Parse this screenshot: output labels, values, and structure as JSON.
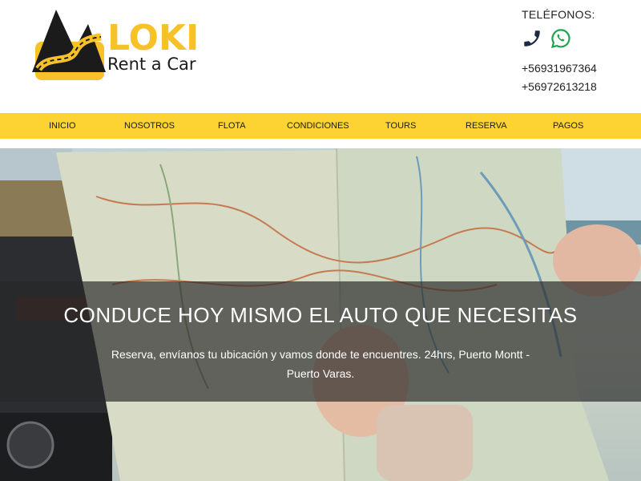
{
  "brand": {
    "name": "LOKI",
    "tagline": "Rent a Car",
    "color_primary": "#fcd333",
    "color_dark": "#1b1b1b"
  },
  "contact": {
    "title": "TELÉFONOS:",
    "icons": [
      "phone-icon",
      "whatsapp-icon"
    ],
    "phones": [
      "+56931967364",
      "+56972613218"
    ]
  },
  "nav": {
    "items": [
      "INICIO",
      "NOSOTROS",
      "FLOTA",
      "CONDICIONES",
      "TOURS",
      "RESERVA",
      "PAGOS"
    ]
  },
  "hero": {
    "title": "CONDUCE HOY MISMO EL AUTO QUE NECESITAS",
    "subtitle": "Reserva, envíanos tu ubicación y vamos donde te encuentres. 24hrs, Puerto Montt - Puerto Varas."
  }
}
